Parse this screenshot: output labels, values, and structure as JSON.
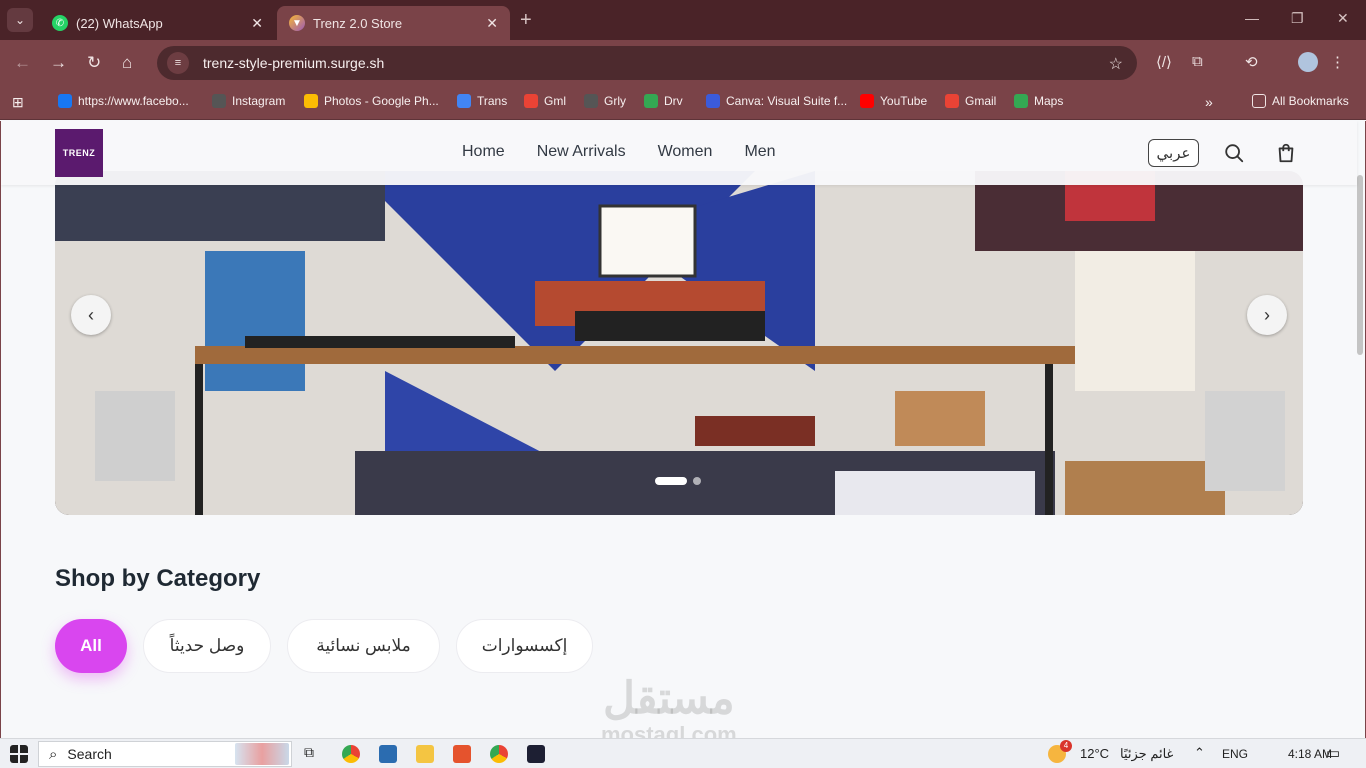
{
  "browser": {
    "tabs": [
      {
        "label": "(22) WhatsApp",
        "active": false
      },
      {
        "label": "Trenz 2.0 Store",
        "active": true
      }
    ],
    "url": "trenz-style-premium.surge.sh",
    "bookmarks": [
      {
        "label": "https://www.facebo...",
        "icon": "facebook-icon",
        "color": "#1877f2"
      },
      {
        "label": "Instagram",
        "icon": "globe-icon",
        "color": "#555555"
      },
      {
        "label": "Photos - Google Ph...",
        "icon": "photos-icon",
        "color": "#fbbc04"
      },
      {
        "label": "Trans",
        "icon": "translate-icon",
        "color": "#4285f4"
      },
      {
        "label": "Gml",
        "icon": "gmail-icon",
        "color": "#ea4335"
      },
      {
        "label": "Grly",
        "icon": "globe-icon",
        "color": "#555555"
      },
      {
        "label": "Drv",
        "icon": "drive-icon",
        "color": "#34a853"
      },
      {
        "label": "Canva: Visual Suite f...",
        "icon": "canva-icon",
        "color": "#3b5bdb"
      },
      {
        "label": "YouTube",
        "icon": "youtube-icon",
        "color": "#ff0000"
      },
      {
        "label": "Gmail",
        "icon": "gmail-icon",
        "color": "#ea4335"
      },
      {
        "label": "Maps",
        "icon": "maps-icon",
        "color": "#34a853"
      }
    ],
    "all_bookmarks": "All Bookmarks"
  },
  "site": {
    "logo_text": "TRENZ",
    "nav": [
      "Home",
      "New Arrivals",
      "Women",
      "Men"
    ],
    "lang_button": "عربي",
    "section_title": "Shop by Category",
    "categories": [
      {
        "label": "All",
        "active": true
      },
      {
        "label": "وصل حديثاً",
        "active": false
      },
      {
        "label": "ملابس نسائية",
        "active": false
      },
      {
        "label": "إكسسوارات",
        "active": false
      }
    ],
    "carousel": {
      "slides": 2,
      "current": 1
    },
    "accent_color": "#d946ef"
  },
  "watermark": {
    "arabic": "مستقل",
    "latin": "mostaql.com"
  },
  "taskbar": {
    "search_placeholder": "Search",
    "weather": "12°C",
    "weather_desc": "غائم جزئيًا",
    "weather_badge": "4",
    "language": "ENG",
    "time": "4:18 AM"
  }
}
